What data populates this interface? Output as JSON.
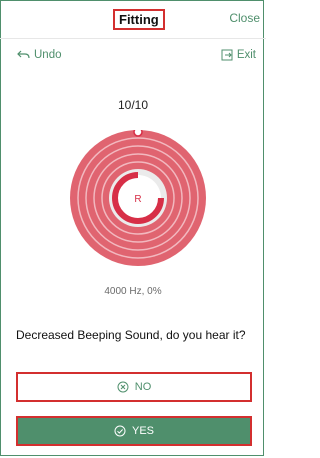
{
  "header": {
    "title": "Fitting",
    "close_label": "Close"
  },
  "toolbar": {
    "undo_label": "Undo",
    "exit_label": "Exit"
  },
  "test": {
    "progress": "10/10",
    "ear": "R",
    "reading": "4000 Hz, 0%",
    "question": "Decreased Beeping Sound, do you hear it?"
  },
  "actions": {
    "no_label": "NO",
    "yes_label": "YES"
  },
  "colors": {
    "accent": "#4f8f6c",
    "ring": "#e06470",
    "ring_dark": "#d72f47",
    "highlight": "#d32f2f"
  },
  "icons": {
    "undo": "undo-arrow-icon",
    "exit": "exit-icon",
    "no": "x-circle-icon",
    "yes": "check-circle-icon"
  }
}
